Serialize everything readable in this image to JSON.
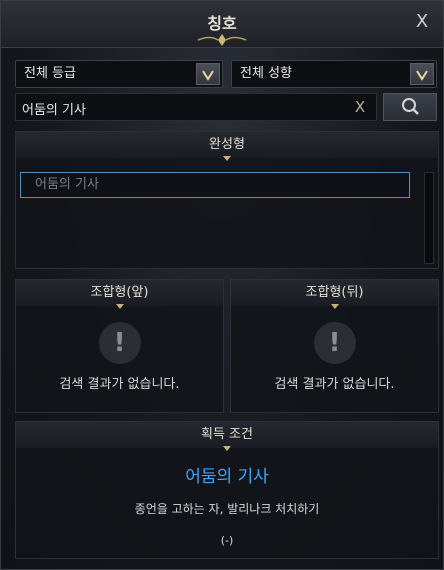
{
  "window": {
    "title": "칭호",
    "close_glyph": "X"
  },
  "filters": {
    "grade": {
      "value": "전체 등급"
    },
    "tendency": {
      "value": "전체 성향"
    }
  },
  "search": {
    "value": "어둠의 기사",
    "clear_glyph": "X"
  },
  "complete": {
    "header": "완성형",
    "items": [
      "어둠의 기사"
    ]
  },
  "combo_front": {
    "header": "조합형(앞)",
    "empty_text": "검색 결과가 없습니다."
  },
  "combo_back": {
    "header": "조합형(뒤)",
    "empty_text": "검색 결과가 없습니다."
  },
  "condition": {
    "header": "획득 조건",
    "title_name": "어둠의 기사",
    "description": "종언을 고하는 자, 발리나크 처치하기",
    "progress": "(-)"
  },
  "colors": {
    "accent_blue": "#3da7ff",
    "gold": "#c9b27a",
    "highlight_border": "#5b8fb8"
  },
  "icons": [
    "ornament-icon",
    "close-icon",
    "chevron-down-icon",
    "search-icon",
    "clear-icon",
    "exclamation-icon"
  ]
}
